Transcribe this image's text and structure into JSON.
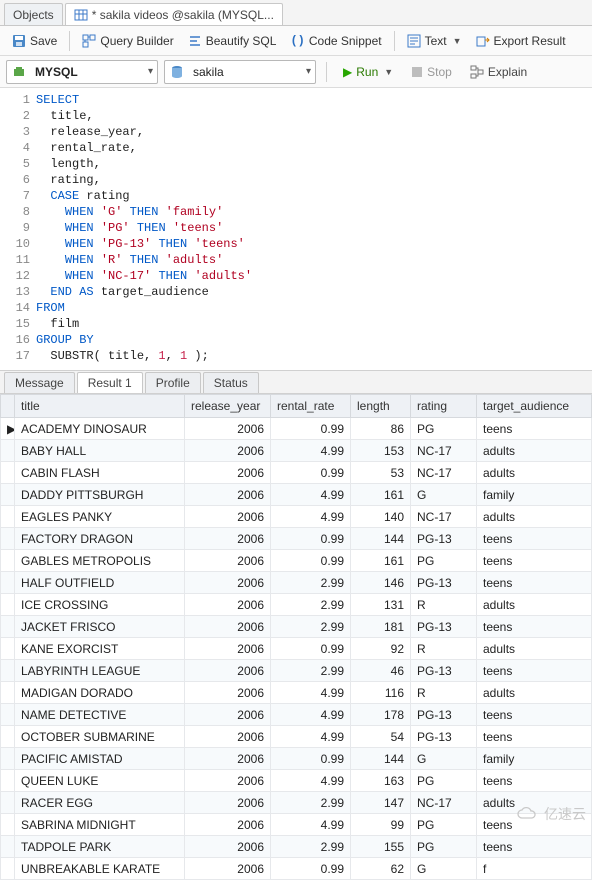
{
  "tabs": {
    "objects": "Objects",
    "editor": "* sakila videos @sakila (MYSQL..."
  },
  "toolbar": {
    "save": "Save",
    "query_builder": "Query Builder",
    "beautify_sql": "Beautify SQL",
    "code_snippet": "Code Snippet",
    "text": "Text",
    "export_result": "Export Result"
  },
  "toolbar2": {
    "engine": "MYSQL",
    "schema": "sakila",
    "run": "Run",
    "stop": "Stop",
    "explain": "Explain"
  },
  "sql": {
    "lines": [
      {
        "n": 1,
        "html": "<span class='kw'>SELECT</span>"
      },
      {
        "n": 2,
        "html": "  title,"
      },
      {
        "n": 3,
        "html": "  release_year,"
      },
      {
        "n": 4,
        "html": "  rental_rate,"
      },
      {
        "n": 5,
        "html": "  length,"
      },
      {
        "n": 6,
        "html": "  rating,"
      },
      {
        "n": 7,
        "html": "  <span class='kw'>CASE</span> rating",
        "fold": true
      },
      {
        "n": 8,
        "html": "    <span class='kw'>WHEN</span> <span class='str'>'G'</span> <span class='kw'>THEN</span> <span class='str'>'family'</span>"
      },
      {
        "n": 9,
        "html": "    <span class='kw'>WHEN</span> <span class='str'>'PG'</span> <span class='kw'>THEN</span> <span class='str'>'teens'</span>"
      },
      {
        "n": 10,
        "html": "    <span class='kw'>WHEN</span> <span class='str'>'PG-13'</span> <span class='kw'>THEN</span> <span class='str'>'teens'</span>"
      },
      {
        "n": 11,
        "html": "    <span class='kw'>WHEN</span> <span class='str'>'R'</span> <span class='kw'>THEN</span> <span class='str'>'adults'</span>"
      },
      {
        "n": 12,
        "html": "    <span class='kw'>WHEN</span> <span class='str'>'NC-17'</span> <span class='kw'>THEN</span> <span class='str'>'adults'</span>"
      },
      {
        "n": 13,
        "html": "  <span class='kw'>END AS</span> target_audience"
      },
      {
        "n": 14,
        "html": "<span class='kw'>FROM</span>"
      },
      {
        "n": 15,
        "html": "  film"
      },
      {
        "n": 16,
        "html": "<span class='kw'>GROUP BY</span>"
      },
      {
        "n": 17,
        "html": "  SUBSTR( title, <span class='num'>1</span>, <span class='num'>1</span> );"
      }
    ]
  },
  "bottom_tabs": {
    "message": "Message",
    "result1": "Result 1",
    "profile": "Profile",
    "status": "Status"
  },
  "grid": {
    "columns": [
      "title",
      "release_year",
      "rental_rate",
      "length",
      "rating",
      "target_audience"
    ],
    "rows": [
      {
        "marker": "▶",
        "title": "ACADEMY DINOSAUR",
        "release_year": "2006",
        "rental_rate": "0.99",
        "length": "86",
        "rating": "PG",
        "target_audience": "teens"
      },
      {
        "marker": "",
        "title": "BABY HALL",
        "release_year": "2006",
        "rental_rate": "4.99",
        "length": "153",
        "rating": "NC-17",
        "target_audience": "adults"
      },
      {
        "marker": "",
        "title": "CABIN FLASH",
        "release_year": "2006",
        "rental_rate": "0.99",
        "length": "53",
        "rating": "NC-17",
        "target_audience": "adults"
      },
      {
        "marker": "",
        "title": "DADDY PITTSBURGH",
        "release_year": "2006",
        "rental_rate": "4.99",
        "length": "161",
        "rating": "G",
        "target_audience": "family"
      },
      {
        "marker": "",
        "title": "EAGLES PANKY",
        "release_year": "2006",
        "rental_rate": "4.99",
        "length": "140",
        "rating": "NC-17",
        "target_audience": "adults"
      },
      {
        "marker": "",
        "title": "FACTORY DRAGON",
        "release_year": "2006",
        "rental_rate": "0.99",
        "length": "144",
        "rating": "PG-13",
        "target_audience": "teens"
      },
      {
        "marker": "",
        "title": "GABLES METROPOLIS",
        "release_year": "2006",
        "rental_rate": "0.99",
        "length": "161",
        "rating": "PG",
        "target_audience": "teens"
      },
      {
        "marker": "",
        "title": "HALF OUTFIELD",
        "release_year": "2006",
        "rental_rate": "2.99",
        "length": "146",
        "rating": "PG-13",
        "target_audience": "teens"
      },
      {
        "marker": "",
        "title": "ICE CROSSING",
        "release_year": "2006",
        "rental_rate": "2.99",
        "length": "131",
        "rating": "R",
        "target_audience": "adults"
      },
      {
        "marker": "",
        "title": "JACKET FRISCO",
        "release_year": "2006",
        "rental_rate": "2.99",
        "length": "181",
        "rating": "PG-13",
        "target_audience": "teens"
      },
      {
        "marker": "",
        "title": "KANE EXORCIST",
        "release_year": "2006",
        "rental_rate": "0.99",
        "length": "92",
        "rating": "R",
        "target_audience": "adults"
      },
      {
        "marker": "",
        "title": "LABYRINTH LEAGUE",
        "release_year": "2006",
        "rental_rate": "2.99",
        "length": "46",
        "rating": "PG-13",
        "target_audience": "teens"
      },
      {
        "marker": "",
        "title": "MADIGAN DORADO",
        "release_year": "2006",
        "rental_rate": "4.99",
        "length": "116",
        "rating": "R",
        "target_audience": "adults"
      },
      {
        "marker": "",
        "title": "NAME DETECTIVE",
        "release_year": "2006",
        "rental_rate": "4.99",
        "length": "178",
        "rating": "PG-13",
        "target_audience": "teens"
      },
      {
        "marker": "",
        "title": "OCTOBER SUBMARINE",
        "release_year": "2006",
        "rental_rate": "4.99",
        "length": "54",
        "rating": "PG-13",
        "target_audience": "teens"
      },
      {
        "marker": "",
        "title": "PACIFIC AMISTAD",
        "release_year": "2006",
        "rental_rate": "0.99",
        "length": "144",
        "rating": "G",
        "target_audience": "family"
      },
      {
        "marker": "",
        "title": "QUEEN LUKE",
        "release_year": "2006",
        "rental_rate": "4.99",
        "length": "163",
        "rating": "PG",
        "target_audience": "teens"
      },
      {
        "marker": "",
        "title": "RACER EGG",
        "release_year": "2006",
        "rental_rate": "2.99",
        "length": "147",
        "rating": "NC-17",
        "target_audience": "adults"
      },
      {
        "marker": "",
        "title": "SABRINA MIDNIGHT",
        "release_year": "2006",
        "rental_rate": "4.99",
        "length": "99",
        "rating": "PG",
        "target_audience": "teens"
      },
      {
        "marker": "",
        "title": "TADPOLE PARK",
        "release_year": "2006",
        "rental_rate": "2.99",
        "length": "155",
        "rating": "PG",
        "target_audience": "teens"
      },
      {
        "marker": "",
        "title": "UNBREAKABLE KARATE",
        "release_year": "2006",
        "rental_rate": "0.99",
        "length": "62",
        "rating": "G",
        "target_audience": "f"
      }
    ]
  },
  "watermark": "亿速云"
}
